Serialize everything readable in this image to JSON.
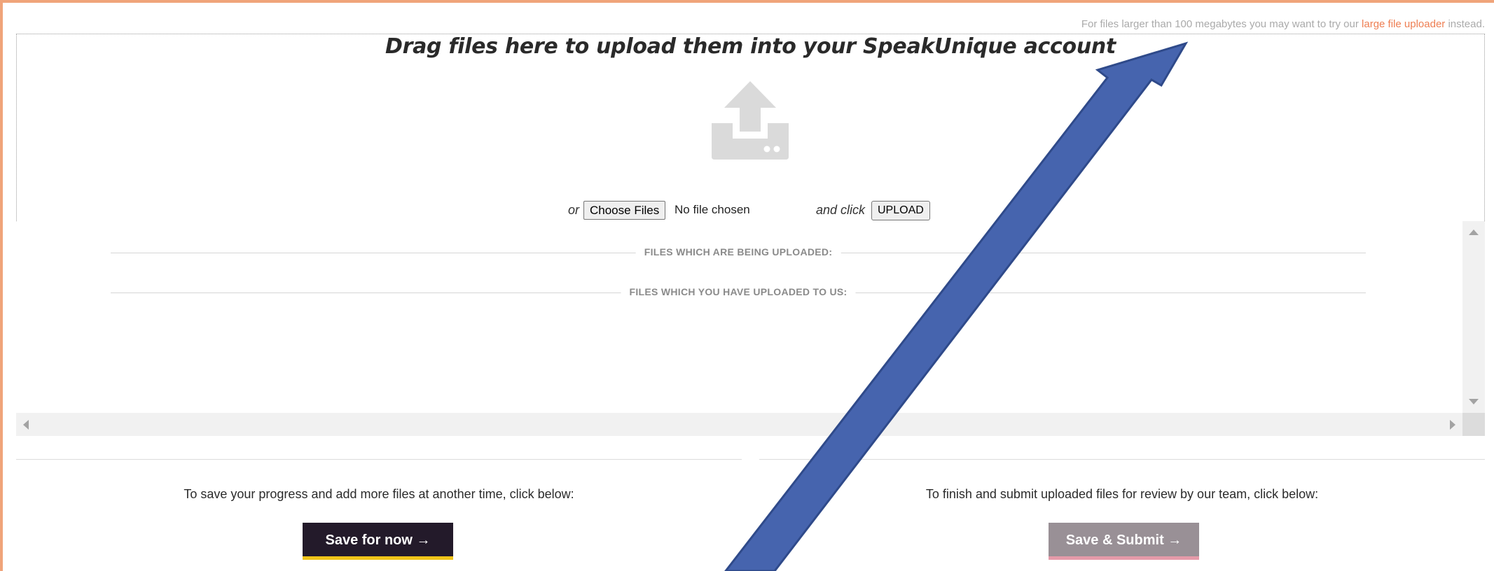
{
  "notice": {
    "prefix": "For files larger than 100 megabytes you may want to try our",
    "link": "large file uploader",
    "suffix": "instead."
  },
  "dropzone": {
    "title": "Drag files here to upload them into your SpeakUnique account",
    "icon": "upload-tray-icon"
  },
  "picker": {
    "or_label": "or",
    "choose_label": "Choose Files",
    "no_file_label": "No file chosen",
    "and_click_label": "and click",
    "upload_label": "UPLOAD"
  },
  "sections": {
    "uploading": "FILES WHICH ARE BEING UPLOADED:",
    "uploaded": "FILES WHICH YOU HAVE UPLOADED TO US:"
  },
  "save_panel": {
    "hint": "To save your progress and add more files at another time, click below:",
    "button": "Save for now →"
  },
  "submit_panel": {
    "hint": "To finish and submit uploaded files for review by our team, click below:",
    "button": "Save & Submit →"
  },
  "colors": {
    "frame_border": "#f0a47a",
    "link": "#ee7e52",
    "save_button_bg": "#231a2a",
    "save_button_accent": "#f0c419",
    "submit_button_bg": "#999096",
    "submit_button_accent": "#e59aa9",
    "annotation_arrow": "#4664ae"
  }
}
